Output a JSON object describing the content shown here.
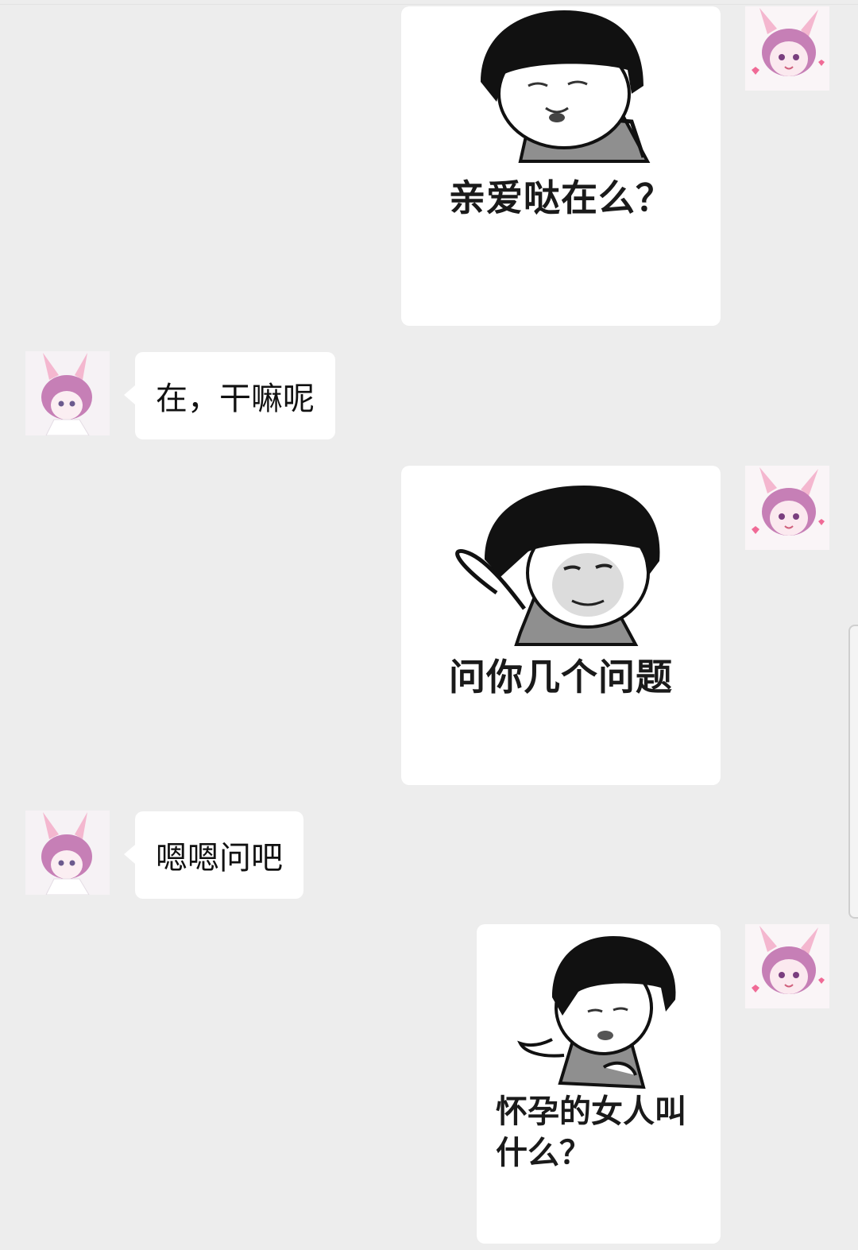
{
  "messages": [
    {
      "side": "right",
      "type": "sticker",
      "caption": "亲爱哒在么？",
      "avatar_icon": "bunny-girl-avatar-icon"
    },
    {
      "side": "left",
      "type": "text",
      "text": "在，干嘛呢",
      "avatar_icon": "bunny-boy-avatar-icon"
    },
    {
      "side": "right",
      "type": "sticker",
      "caption": "问你几个问题",
      "avatar_icon": "bunny-girl-avatar-icon"
    },
    {
      "side": "left",
      "type": "text",
      "text": "嗯嗯问吧",
      "avatar_icon": "bunny-boy-avatar-icon"
    },
    {
      "side": "right",
      "type": "sticker",
      "caption_line1": "怀孕的女人叫",
      "caption_line2": "什么？",
      "avatar_icon": "bunny-girl-avatar-icon"
    }
  ],
  "colors": {
    "background": "#ededed",
    "bubble": "#ffffff",
    "text": "#111111",
    "avatar_hair": "#c67fb6",
    "avatar_ears": "#f4b7cf"
  }
}
